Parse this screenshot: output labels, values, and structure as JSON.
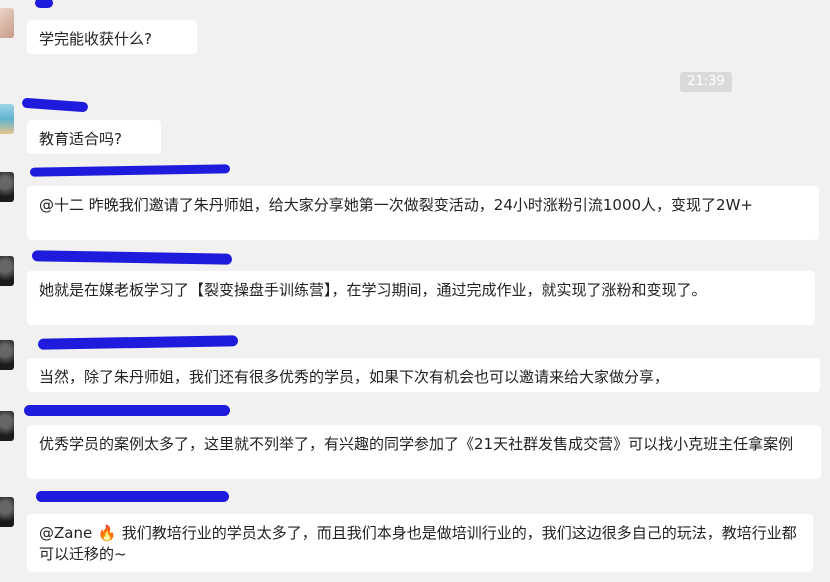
{
  "messages": [
    {
      "text": "学完能收获什么?"
    },
    {
      "text": "教育适合吗?"
    },
    {
      "text": "@十二 昨晚我们邀请了朱丹师姐，给大家分享她第一次做裂变活动，24小时涨粉引流1000人，变现了2W+"
    },
    {
      "text": "她就是在媒老板学习了【裂变操盘手训练营】，在学习期间，通过完成作业，就实现了涨粉和变现了。"
    },
    {
      "text": "当然，除了朱丹师姐，我们还有很多优秀的学员，如果下次有机会也可以邀请来给大家做分享，"
    },
    {
      "text": "优秀学员的案例太多了，这里就不列举了，有兴趣的同学参加了《21天社群发售成交营》可以找小克班主任拿案例"
    },
    {
      "mention": "@Zane",
      "emoji": "🔥",
      "text": "我们教培行业的学员太多了，而且我们本身也是做培训行业的，我们这边很多自己的玩法，教培行业都可以迁移的~"
    }
  ],
  "timestamp": "21:39",
  "colors": {
    "scribble": "#1f1bdc",
    "bubble": "#ffffff",
    "background": "#f1f1f1"
  }
}
